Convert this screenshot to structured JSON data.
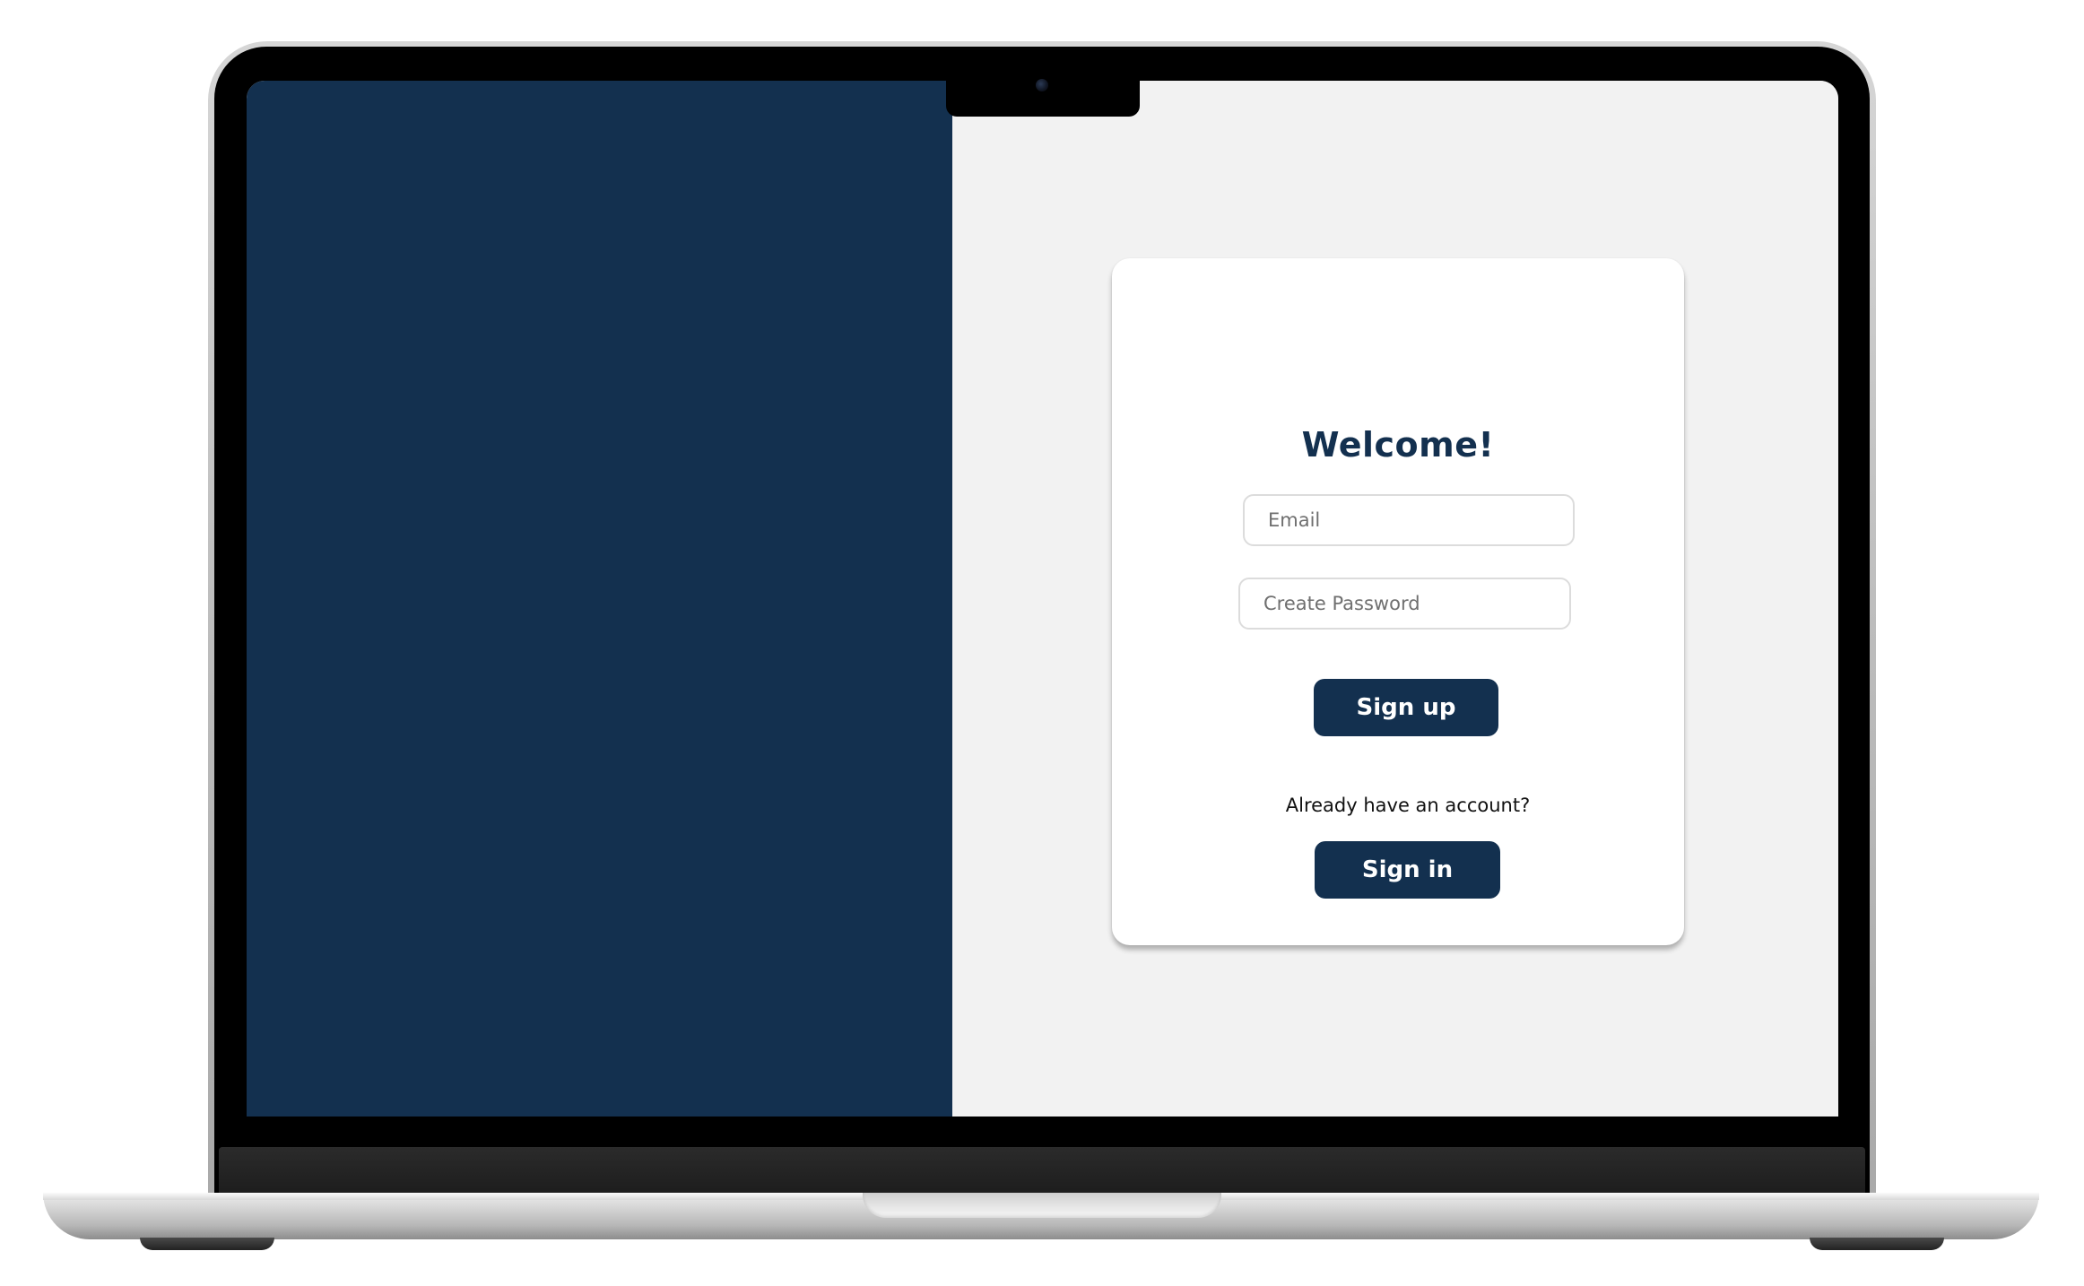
{
  "signup_form": {
    "title": "Welcome!",
    "email_placeholder": "Email",
    "password_placeholder": "Create Password",
    "signup_label": "Sign up",
    "account_prompt": "Already have an account?",
    "signin_label": "Sign in"
  },
  "colors": {
    "brand_navy": "#13304f",
    "right_panel_bg": "#f2f2f2",
    "card_bg": "#ffffff",
    "input_border": "#dcdcdc"
  },
  "device": {
    "frame": "laptop-mockup"
  }
}
